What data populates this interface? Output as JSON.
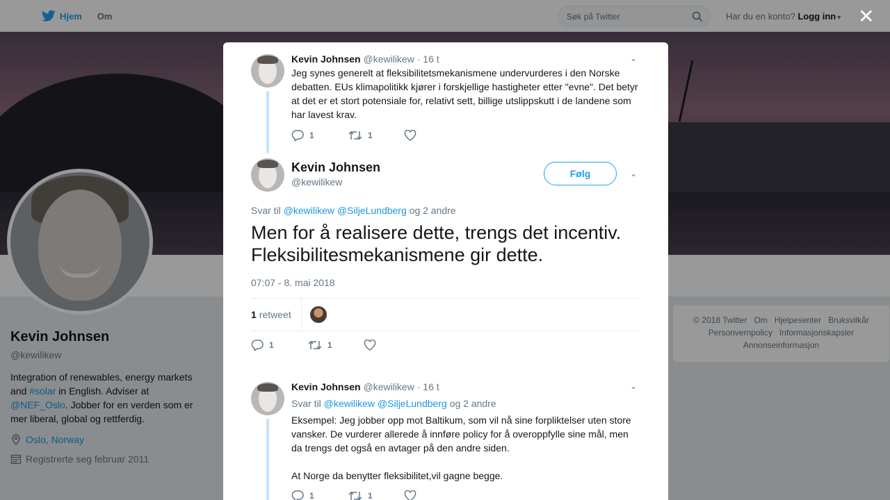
{
  "topbar": {
    "home_label": "Hjem",
    "about_label": "Om",
    "search_placeholder": "Søk på Twitter",
    "account_prompt": "Har du en konto?",
    "login_label": "Logg inn"
  },
  "profile": {
    "name": "Kevin Johnsen",
    "handle": "@kewilikew",
    "bio_part1": "Integration of renewables, energy markets and ",
    "bio_hashtag": "#solar",
    "bio_part2": " in English. Adviser at ",
    "bio_mention": "@NEF_Oslo",
    "bio_part3": ". Jobber for en verden som er mer liberal, global og rettferdig.",
    "location": "Oslo, Norway",
    "joined": "Registrerte seg februar 2011"
  },
  "footer": {
    "links": [
      "© 2018 Twitter",
      "Om",
      "Hjelpesenter",
      "Bruksvilkår",
      "Personvernpolicy",
      "Informasjonskapsler",
      "Annonseinformasjon"
    ]
  },
  "modal": {
    "parent_tweet": {
      "name": "Kevin Johnsen",
      "handle": "@kewilikew",
      "time": "16 t",
      "text_lines": [
        "Jeg synes generelt at fleksibilitetsmekanismene undervurderes i den Norske",
        "debatten. EUs klimapolitikk kjører i forskjellige hastigheter etter \"evne\". Det betyr",
        "at det er et stort potensiale for, relativt sett, billige utslippskutt i de landene som",
        "har lavest krav."
      ],
      "replies": "1",
      "retweets": "1"
    },
    "main_tweet": {
      "name": "Kevin Johnsen",
      "handle": "@kewilikew",
      "follow_label": "Følg",
      "reply_to_label": "Svar til",
      "reply_to_1": "@kewilikew",
      "reply_to_2": "@SiljeLundberg",
      "reply_to_more": "og 2 andre",
      "text_line1": "Men for å realisere dette, trengs det incentiv.",
      "text_line2": "Fleksibilitesmekanismene gir dette.",
      "timestamp": "07:07 - 8. mai 2018",
      "retweet_count": "1",
      "retweet_label": "retweet",
      "replies": "1",
      "retweets": "1"
    },
    "reply_tweet": {
      "name": "Kevin Johnsen",
      "handle": "@kewilikew",
      "time": "16 t",
      "reply_to_label": "Svar til",
      "reply_to_1": "@kewilikew",
      "reply_to_2": "@SiljeLundberg",
      "reply_to_more": "og 2 andre",
      "text_lines": [
        "Eksempel: Jeg jobber opp mot Baltikum, som vil nå sine forpliktelser uten store",
        "vansker.  De vurderer allerede å innføre policy for å overoppfylle sine mål, men",
        "da trengs det også en avtager på den andre siden.",
        "",
        "At Norge da benytter fleksibilitet,vil gagne begge."
      ],
      "replies": "1",
      "retweets": "1"
    }
  },
  "colors": {
    "accent": "#1da1f2",
    "link": "#1b95e0",
    "muted": "#657786"
  }
}
